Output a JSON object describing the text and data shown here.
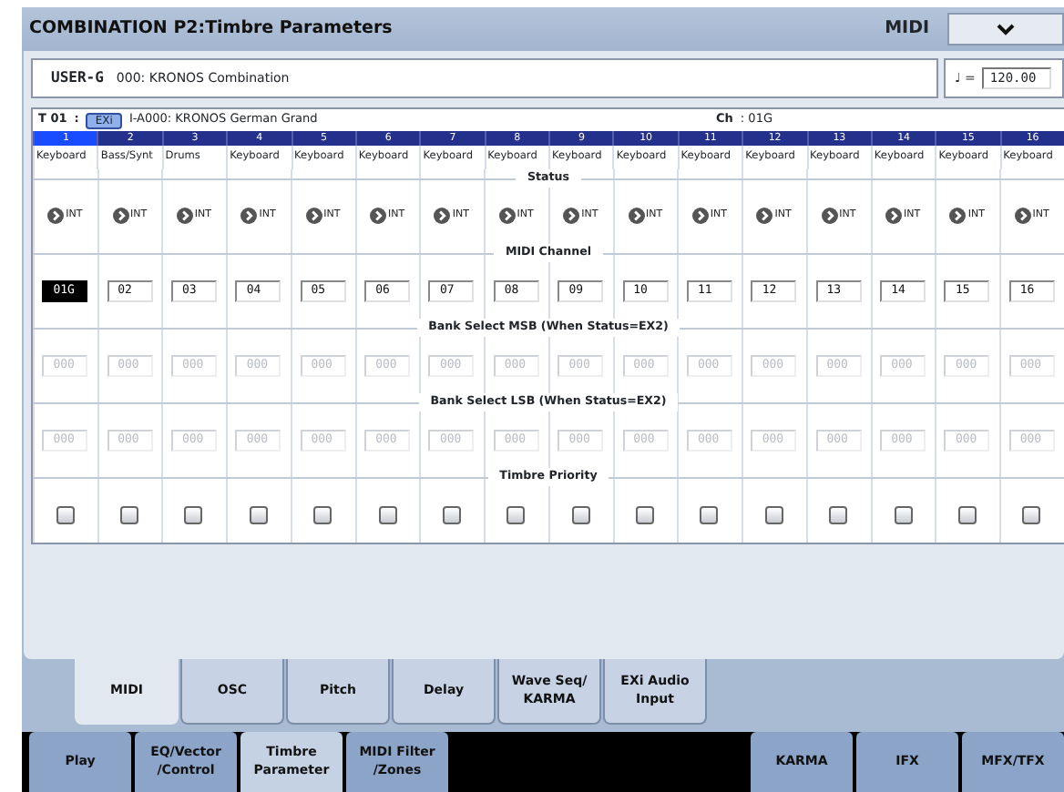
{
  "window": {
    "title": "COMBINATION P2:Timbre Parameters",
    "mode": "MIDI"
  },
  "program": {
    "bank": "USER-G",
    "name": "000: KRONOS Combination"
  },
  "tempo": {
    "symbol": "♩ =",
    "value": "120.00"
  },
  "timbre_info": {
    "track": "T 01",
    "separator": ":",
    "badge": "EXi",
    "program": "I-A000: KRONOS German Grand",
    "channel_label": "Ch",
    "channel_value": ": 01G"
  },
  "sections": [
    {
      "kind": "status",
      "title": "Status",
      "disabled": false
    },
    {
      "kind": "midi_channel",
      "title": "MIDI Channel",
      "disabled": false
    },
    {
      "kind": "bank_msb",
      "title": "Bank Select MSB (When Status=EX2)",
      "disabled": true
    },
    {
      "kind": "bank_lsb",
      "title": "Bank Select LSB (When Status=EX2)",
      "disabled": true
    },
    {
      "kind": "priority",
      "title": "Timbre Priority",
      "disabled": false
    }
  ],
  "timbres": [
    {
      "number": "1",
      "selected": true,
      "category": "Keyboard",
      "status": "INT",
      "midi_channel": "01G",
      "bank_msb": "000",
      "bank_lsb": "000",
      "priority": false
    },
    {
      "number": "2",
      "selected": false,
      "category": "Bass/Synt",
      "status": "INT",
      "midi_channel": "02",
      "bank_msb": "000",
      "bank_lsb": "000",
      "priority": false
    },
    {
      "number": "3",
      "selected": false,
      "category": "Drums",
      "status": "INT",
      "midi_channel": "03",
      "bank_msb": "000",
      "bank_lsb": "000",
      "priority": false
    },
    {
      "number": "4",
      "selected": false,
      "category": "Keyboard",
      "status": "INT",
      "midi_channel": "04",
      "bank_msb": "000",
      "bank_lsb": "000",
      "priority": false
    },
    {
      "number": "5",
      "selected": false,
      "category": "Keyboard",
      "status": "INT",
      "midi_channel": "05",
      "bank_msb": "000",
      "bank_lsb": "000",
      "priority": false
    },
    {
      "number": "6",
      "selected": false,
      "category": "Keyboard",
      "status": "INT",
      "midi_channel": "06",
      "bank_msb": "000",
      "bank_lsb": "000",
      "priority": false
    },
    {
      "number": "7",
      "selected": false,
      "category": "Keyboard",
      "status": "INT",
      "midi_channel": "07",
      "bank_msb": "000",
      "bank_lsb": "000",
      "priority": false
    },
    {
      "number": "8",
      "selected": false,
      "category": "Keyboard",
      "status": "INT",
      "midi_channel": "08",
      "bank_msb": "000",
      "bank_lsb": "000",
      "priority": false
    },
    {
      "number": "9",
      "selected": false,
      "category": "Keyboard",
      "status": "INT",
      "midi_channel": "09",
      "bank_msb": "000",
      "bank_lsb": "000",
      "priority": false
    },
    {
      "number": "10",
      "selected": false,
      "category": "Keyboard",
      "status": "INT",
      "midi_channel": "10",
      "bank_msb": "000",
      "bank_lsb": "000",
      "priority": false
    },
    {
      "number": "11",
      "selected": false,
      "category": "Keyboard",
      "status": "INT",
      "midi_channel": "11",
      "bank_msb": "000",
      "bank_lsb": "000",
      "priority": false
    },
    {
      "number": "12",
      "selected": false,
      "category": "Keyboard",
      "status": "INT",
      "midi_channel": "12",
      "bank_msb": "000",
      "bank_lsb": "000",
      "priority": false
    },
    {
      "number": "13",
      "selected": false,
      "category": "Keyboard",
      "status": "INT",
      "midi_channel": "13",
      "bank_msb": "000",
      "bank_lsb": "000",
      "priority": false
    },
    {
      "number": "14",
      "selected": false,
      "category": "Keyboard",
      "status": "INT",
      "midi_channel": "14",
      "bank_msb": "000",
      "bank_lsb": "000",
      "priority": false
    },
    {
      "number": "15",
      "selected": false,
      "category": "Keyboard",
      "status": "INT",
      "midi_channel": "15",
      "bank_msb": "000",
      "bank_lsb": "000",
      "priority": false
    },
    {
      "number": "16",
      "selected": false,
      "category": "Keyboard",
      "status": "INT",
      "midi_channel": "16",
      "bank_msb": "000",
      "bank_lsb": "000",
      "priority": false
    }
  ],
  "tabs": [
    {
      "label": "MIDI",
      "selected": true
    },
    {
      "label": "OSC",
      "selected": false
    },
    {
      "label": "Pitch",
      "selected": false
    },
    {
      "label": "Delay",
      "selected": false
    },
    {
      "label": "Wave Seq/\nKARMA",
      "selected": false
    },
    {
      "label": "EXi Audio\nInput",
      "selected": false
    }
  ],
  "page_buttons_left": [
    {
      "label": "Play",
      "selected": false
    },
    {
      "label": "EQ/Vector\n/Control",
      "selected": false
    },
    {
      "label": "Timbre\nParameter",
      "selected": true
    },
    {
      "label": "MIDI Filter\n/Zones",
      "selected": false
    }
  ],
  "page_buttons_right": [
    {
      "label": "KARMA",
      "selected": false
    },
    {
      "label": "IFX",
      "selected": false
    },
    {
      "label": "MFX/TFX",
      "selected": false
    }
  ]
}
